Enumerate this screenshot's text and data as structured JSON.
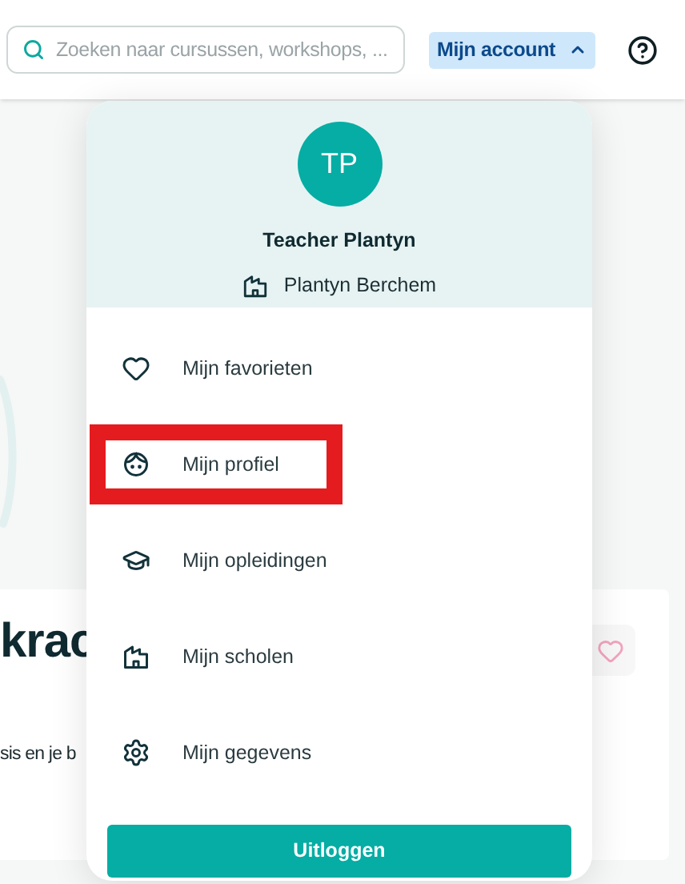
{
  "header": {
    "search": {
      "placeholder": "Zoeken naar cursussen, workshops, ..."
    },
    "account_button": {
      "label": "Mijn account",
      "expanded": true
    }
  },
  "background_card": {
    "title": "krac",
    "text": "sis en je b",
    "favorite": false
  },
  "account_menu": {
    "avatar": "TP",
    "name": "Teacher Plantyn",
    "school": "Plantyn Berchem",
    "items": [
      {
        "label": "Mijn favorieten",
        "kind": "heart",
        "highlighted": false
      },
      {
        "label": "Mijn profiel",
        "kind": "face",
        "highlighted": true
      },
      {
        "label": "Mijn opleidingen",
        "kind": "cap",
        "highlighted": false
      },
      {
        "label": "Mijn scholen",
        "kind": "building",
        "highlighted": false
      },
      {
        "label": "Mijn gegevens",
        "kind": "gear",
        "highlighted": false
      }
    ],
    "logout": "Uitloggen"
  }
}
